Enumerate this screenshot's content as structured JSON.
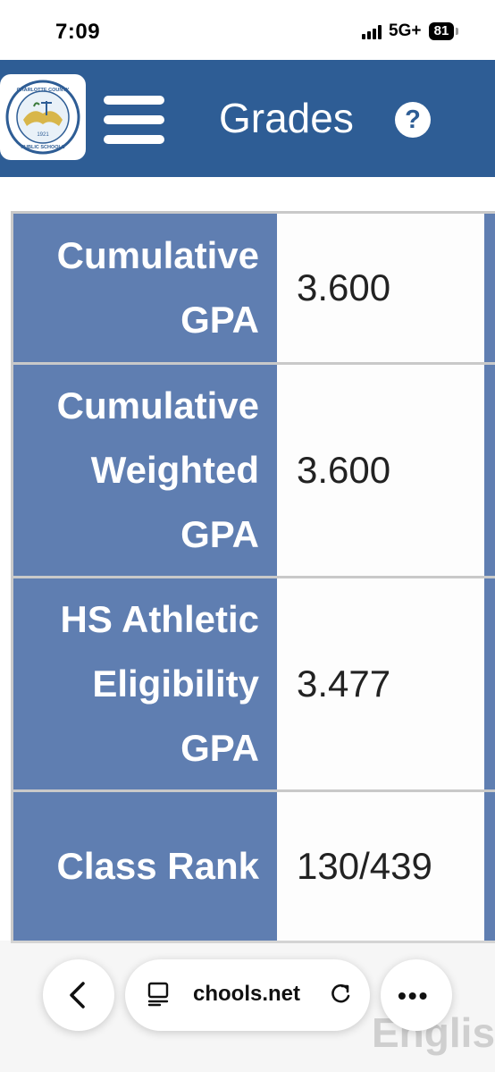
{
  "status_bar": {
    "time": "7:09",
    "network": "5G+",
    "battery": "81"
  },
  "header": {
    "logo_text": "CHARLOTTE COUNTY PUBLIC SCHOOLS",
    "logo_year": "1921",
    "menu_icon": "hamburger-menu-icon",
    "title": "Grades",
    "help_icon": "?"
  },
  "grades_table": {
    "rows": [
      {
        "label": "Cumulative GPA",
        "value": "3.600"
      },
      {
        "label": "Cumulative Weighted GPA",
        "value": "3.600"
      },
      {
        "label": "HS Athletic Eligibility GPA",
        "value": "3.477"
      },
      {
        "label": "Class Rank",
        "value": "130/439"
      }
    ]
  },
  "browser_bar": {
    "url": "chools.net",
    "background_text": "Englis",
    "more_label": "•••"
  },
  "colors": {
    "header": "#2e5d95",
    "label_cell": "#5f7eb1"
  }
}
